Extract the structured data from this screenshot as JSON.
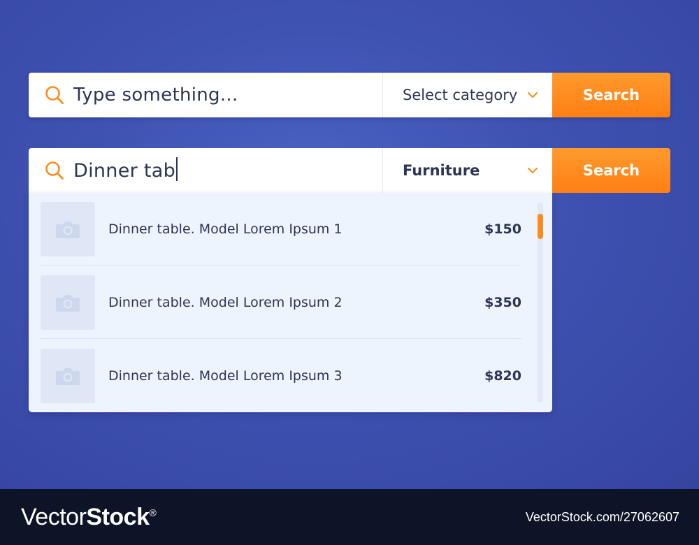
{
  "search_bar_empty": {
    "placeholder": "Type something...",
    "category_label": "Select category",
    "button_label": "Search"
  },
  "search_bar_active": {
    "query": "Dinner tab",
    "category_label": "Furniture",
    "button_label": "Search"
  },
  "results": [
    {
      "name": "Dinner table. Model Lorem Ipsum 1",
      "price": "$150"
    },
    {
      "name": "Dinner table. Model Lorem Ipsum 2",
      "price": "$350"
    },
    {
      "name": "Dinner table. Model Lorem Ipsum 3",
      "price": "$820"
    }
  ],
  "footer": {
    "logo_regular": "Vector",
    "logo_bold": "Stock",
    "logo_mark": "®",
    "image_id": "VectorStock.com/27062607"
  },
  "colors": {
    "accent": "#ff8a1c",
    "background": "#3f53b2",
    "text": "#2c3553"
  }
}
